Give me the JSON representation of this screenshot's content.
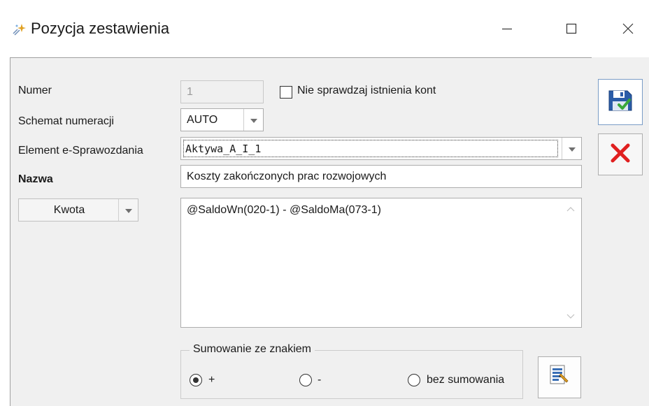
{
  "window": {
    "title": "Pozycja zestawienia",
    "icon": "app-sparkle-icon",
    "controls": {
      "minimize": "minimize-icon",
      "maximize": "maximize-icon",
      "close": "close-icon"
    }
  },
  "form": {
    "numer": {
      "label": "Numer",
      "value": "1"
    },
    "nie_sprawdzaj": {
      "label": "Nie sprawdzaj istnienia kont",
      "checked": false
    },
    "schemat": {
      "label": "Schemat numeracji",
      "value": "AUTO"
    },
    "element": {
      "label": "Element e-Sprawozdania",
      "value": "Aktywa_A_I_1"
    },
    "nazwa": {
      "label": "Nazwa",
      "value": "Koszty zakończonych prac rozwojowych"
    },
    "kwota": {
      "label": "Kwota"
    },
    "formula": {
      "value": "@SaldoWn(020-1) - @SaldoMa(073-1)"
    },
    "sumowanie": {
      "title": "Sumowanie ze znakiem",
      "options": [
        {
          "label": "+",
          "checked": true
        },
        {
          "label": "-",
          "checked": false
        },
        {
          "label": "bez sumowania",
          "checked": false
        }
      ]
    }
  },
  "actions": {
    "save": "save-disk-icon",
    "cancel": "cancel-x-icon",
    "formula_editor": "formula-editor-icon"
  },
  "colors": {
    "panel_bg": "#f0f0f0",
    "save_blue": "#2a5ca8",
    "check_green": "#3aa83a",
    "cancel_red": "#e02020"
  }
}
